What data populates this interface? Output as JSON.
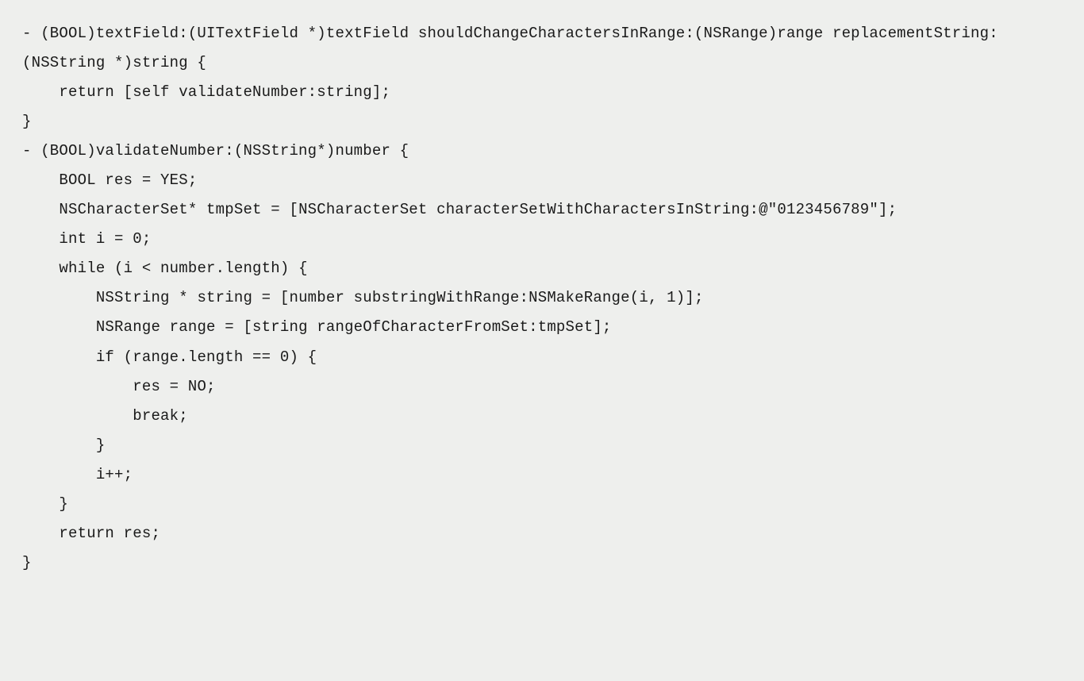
{
  "code": {
    "lines": [
      "- (BOOL)textField:(UITextField *)textField shouldChangeCharactersInRange:(NSRange)range replacementString:(NSString *)string {",
      "    return [self validateNumber:string];",
      "}",
      "",
      "- (BOOL)validateNumber:(NSString*)number {",
      "    BOOL res = YES;",
      "    NSCharacterSet* tmpSet = [NSCharacterSet characterSetWithCharactersInString:@\"0123456789\"];",
      "    int i = 0;",
      "    while (i < number.length) {",
      "        NSString * string = [number substringWithRange:NSMakeRange(i, 1)];",
      "        NSRange range = [string rangeOfCharacterFromSet:tmpSet];",
      "        if (range.length == 0) {",
      "            res = NO;",
      "            break;",
      "        }",
      "        i++;",
      "    }",
      "    return res;",
      "}"
    ]
  }
}
